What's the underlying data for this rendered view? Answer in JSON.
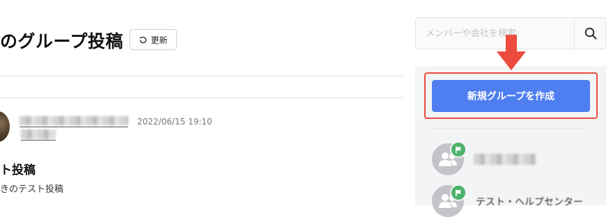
{
  "header": {
    "title": "のグループ投稿",
    "refresh_label": "更新"
  },
  "post": {
    "date": "2022/06/15 19:10",
    "title": "ト投稿",
    "body": "きのテスト投稿"
  },
  "sidebar": {
    "search_placeholder": "メンバーや会社を検索",
    "create_group_label": "新規グループを作成",
    "groups": [
      {
        "name": ""
      },
      {
        "name": "テスト・ヘルプセンター"
      }
    ]
  },
  "colors": {
    "primary": "#4e7ef0",
    "highlight": "#ec4b3d",
    "badge": "#4db36a",
    "panel_bg": "#f3f4f6"
  }
}
